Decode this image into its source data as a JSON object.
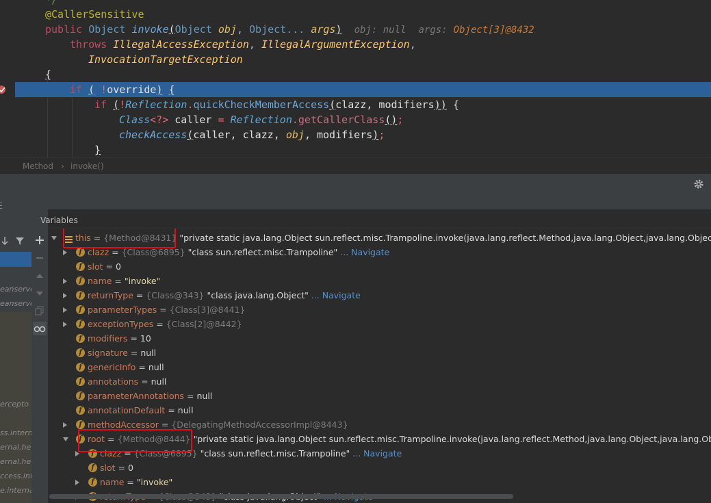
{
  "editor": {
    "comment_tail": "*/",
    "annotation": "@CallerSensitive",
    "sig_public": "public",
    "sig_type": "Object",
    "sig_method": "invoke",
    "sig_open": "(",
    "sig_p1type": "Object",
    "sig_p1name": "obj",
    "sig_p2type": "Object...",
    "sig_p2name": "args",
    "sig_close": ")",
    "hint_obj": "obj: null",
    "hint_args_label": "args:",
    "hint_args_value": "Object[3]@8432",
    "throws_kw": "throws",
    "exc1": "IllegalAccessException",
    "exc2": "IllegalArgumentException",
    "exc3": "InvocationTargetException",
    "brace_open": "{",
    "line_if": "if",
    "line_if_cond": "override",
    "line_if2": "if",
    "reflection": "Reflection",
    "quick_check": "quickCheckMemberAccess",
    "args_clazz_mod": "clazz, modifiers",
    "class_kw": "Class",
    "generic": "<?>",
    "caller": "caller",
    "get_caller": "getCallerClass",
    "check_access": "checkAccess",
    "ca_args_a": "caller, clazz, ",
    "ca_args_obj": "obj",
    "ca_args_b": ", modifiers",
    "brace_close": "}"
  },
  "breadcrumb": {
    "item1": "Method",
    "sep": "›",
    "item2": "invoke()"
  },
  "panel": {
    "variables_label": "Variables"
  },
  "variables": [
    {
      "name": "this",
      "ref": "{Method@8431}",
      "value": "\"private static java.lang.Object sun.reflect.misc.Trampoline.invoke(java.lang.reflect.Method,java.lang.Object,java.lang.Object[]) throws j...",
      "tail": "V"
    },
    {
      "name": "clazz",
      "ref": "{Class@6895}",
      "value": "\"class sun.reflect.misc.Trampoline\"",
      "nav": "... Navigate"
    },
    {
      "name": "slot",
      "value": "0"
    },
    {
      "name": "name",
      "value": "\"invoke\""
    },
    {
      "name": "returnType",
      "ref": "{Class@343}",
      "value": "\"class java.lang.Object\"",
      "nav": "... Navigate"
    },
    {
      "name": "parameterTypes",
      "ref": "{Class[3]@8441}"
    },
    {
      "name": "exceptionTypes",
      "ref": "{Class[2]@8442}"
    },
    {
      "name": "modifiers",
      "value": "10"
    },
    {
      "name": "signature",
      "value": "null"
    },
    {
      "name": "genericInfo",
      "value": "null"
    },
    {
      "name": "annotations",
      "value": "null"
    },
    {
      "name": "parameterAnnotations",
      "value": "null"
    },
    {
      "name": "annotationDefault",
      "value": "null"
    },
    {
      "name": "methodAccessor",
      "ref": "{DelegatingMethodAccessorImpl@8443}"
    },
    {
      "name": "root",
      "ref": "{Method@8444}",
      "value": "\"private static java.lang.Object sun.reflect.misc.Trampoline.invoke(java.lang.reflect.Method,java.lang.Object,java.lang.Object[]) thro...",
      "tail": "V"
    },
    {
      "name": "clazz",
      "ref": "{Class@6895}",
      "value": "\"class sun.reflect.misc.Trampoline\"",
      "nav": "... Navigate"
    },
    {
      "name": "slot",
      "value": "0"
    },
    {
      "name": "name",
      "value": "\"invoke\""
    },
    {
      "name": "returnType",
      "ref": "{Class@343}",
      "value": "\"class java.lang.Object\"",
      "nav": "... Navigate"
    }
  ],
  "frames": [
    "eanserve",
    "eanserve",
    "ercepto",
    "ss.intern",
    "ernal.he",
    "ernal.he",
    "ccess.inte",
    "e.interna"
  ],
  "icons": [
    "breakpoint-icon",
    "settings-gear-icon",
    "add-watch-icon",
    "remove-watch-icon",
    "up-arrow-icon",
    "down-arrow-icon",
    "copy-icon",
    "glasses-icon",
    "filter-icon",
    "object-icon",
    "field-icon"
  ],
  "colors": {
    "highlight": "#2d6099",
    "redbox": "#e0101a",
    "field_icon": "#b58b38"
  }
}
